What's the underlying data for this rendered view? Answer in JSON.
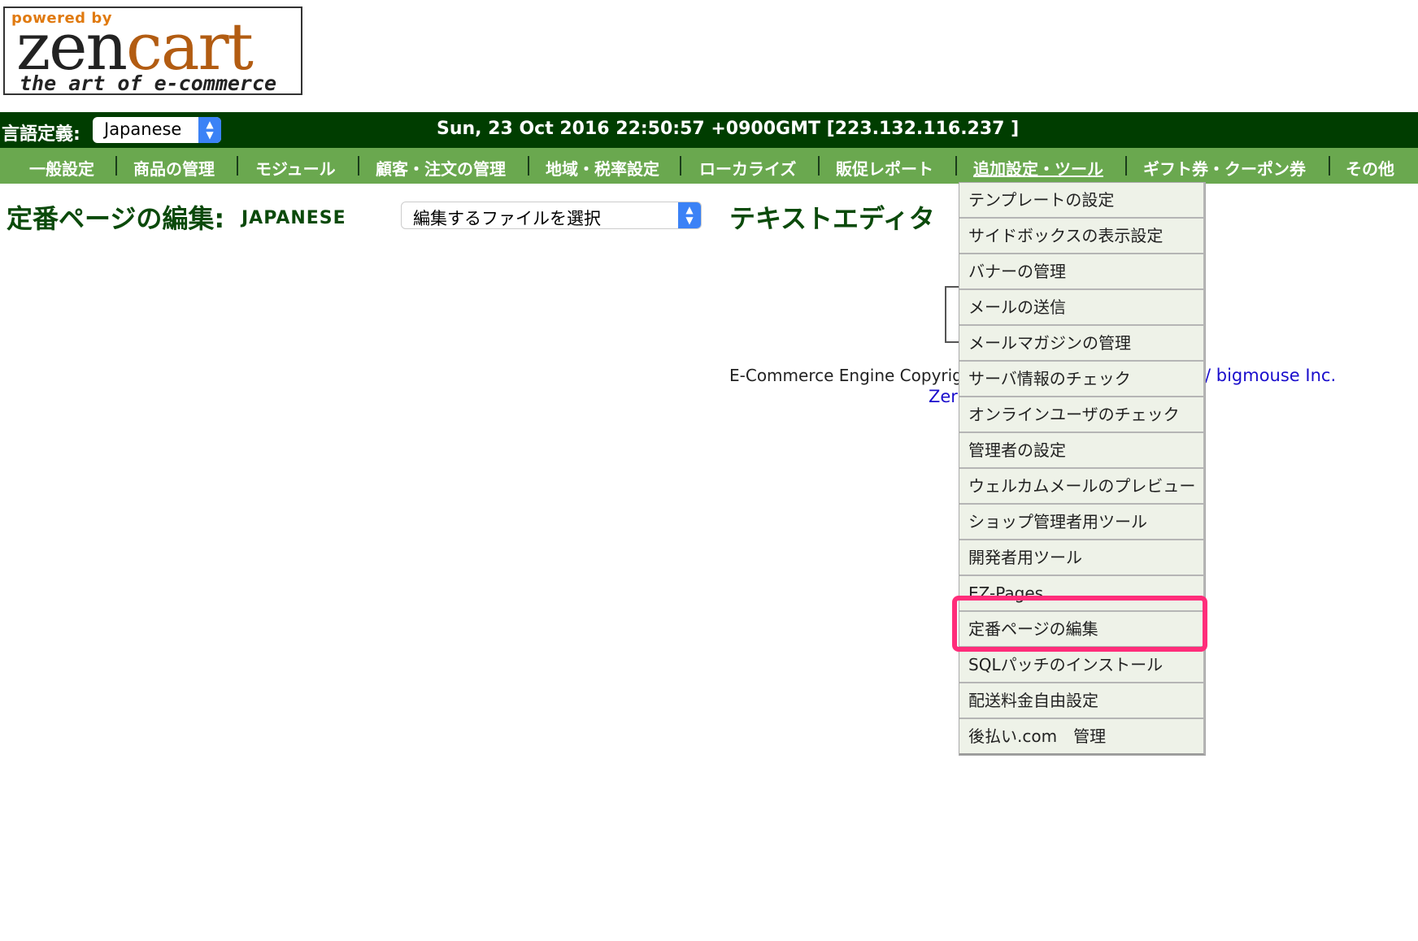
{
  "logo": {
    "powered": "powered by",
    "brand_zen": "zen",
    "brand_cart": "cart",
    "tagline": "the art of e-commerce"
  },
  "topbar": {
    "language_label": "言語定義:",
    "language_value": "Japanese",
    "datetime": "Sun, 23 Oct 2016 22:50:57 +0900GMT [223.132.116.237 ]"
  },
  "nav": {
    "items": [
      "一般設定",
      "商品の管理",
      "モジュール",
      "顧客・注文の管理",
      "地域・税率設定",
      "ローカライズ",
      "販促レポート",
      "追加設定・ツール",
      "ギフト券・クーポン券",
      "その他"
    ],
    "active": "追加設定・ツール"
  },
  "page": {
    "title": "定番ページの編集:",
    "language": "JAPANESE",
    "file_select": "編集するファイルを選択",
    "editor_title": "テキストエディタ"
  },
  "footer": {
    "copyright": "E-Commerce Engine Copyrig",
    "link": "/ bigmouse Inc.",
    "link2": "Zer"
  },
  "dropdown": {
    "items": [
      "テンプレートの設定",
      "サイドボックスの表示設定",
      "バナーの管理",
      "メールの送信",
      "メールマガジンの管理",
      "サーバ情報のチェック",
      "オンラインユーザのチェック",
      "管理者の設定",
      "ウェルカムメールのプレビュー",
      "ショップ管理者用ツール",
      "開発者用ツール",
      "EZ-Pages",
      "定番ページの編集",
      "SQLパッチのインストール",
      "配送料金自由設定",
      "後払い.com　管理"
    ],
    "highlighted": "定番ページの編集"
  },
  "colors": {
    "topbar": "#003d00",
    "navbar": "#6aa84f",
    "heading": "#0b4a0b",
    "highlight": "#ff2d7a"
  }
}
